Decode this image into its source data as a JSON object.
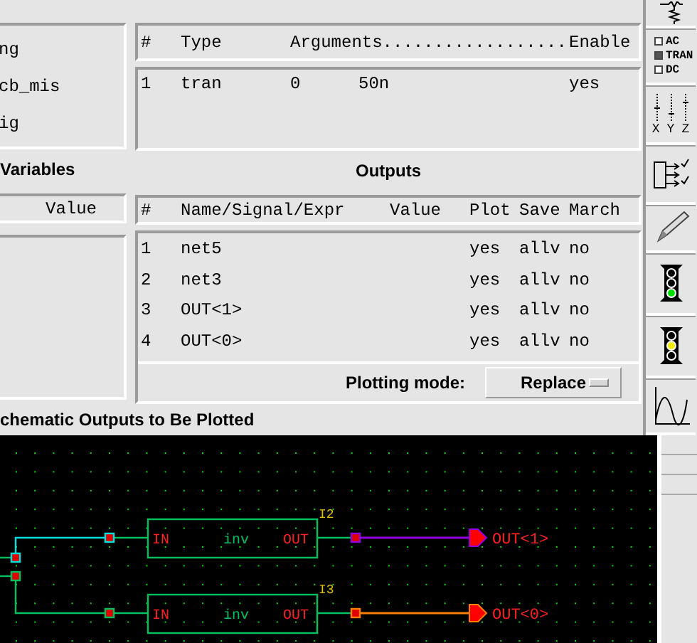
{
  "left_list": {
    "items": [
      "ng",
      "cb_mis",
      "ig"
    ]
  },
  "analyses": {
    "columns": [
      "#",
      "Type",
      "Arguments..................",
      "Enable"
    ],
    "rows": [
      {
        "index": "1",
        "type": "tran",
        "args": [
          "0",
          "50n"
        ],
        "enable": "yes"
      }
    ]
  },
  "variables": {
    "title": "Variables",
    "columns": [
      "Value"
    ]
  },
  "outputs": {
    "title": "Outputs",
    "columns": [
      "#",
      "Name/Signal/Expr",
      "Value",
      "Plot",
      "Save",
      "March"
    ],
    "rows": [
      {
        "index": "1",
        "name": "net5",
        "plot": "yes",
        "save": "allv",
        "march": "no"
      },
      {
        "index": "2",
        "name": "net3",
        "plot": "yes",
        "save": "allv",
        "march": "no"
      },
      {
        "index": "3",
        "name": "OUT<1>",
        "plot": "yes",
        "save": "allv",
        "march": "no"
      },
      {
        "index": "4",
        "name": "OUT<0>",
        "plot": "yes",
        "save": "allv",
        "march": "no"
      }
    ]
  },
  "plotting_mode": {
    "label": "Plotting mode:",
    "value": "Replace"
  },
  "footer": "chematic Outputs to Be Plotted",
  "toolbar": {
    "analysis_types": [
      {
        "label": "AC",
        "selected": false
      },
      {
        "label": "TRAN",
        "selected": true
      },
      {
        "label": "DC",
        "selected": false
      }
    ],
    "axis_labels": [
      "X",
      "Y",
      "Z"
    ]
  },
  "schematic": {
    "instances": [
      {
        "name": "I2",
        "cell": "inv",
        "pins": [
          "IN",
          "OUT"
        ],
        "output": "OUT<1>"
      },
      {
        "name": "I3",
        "cell": "inv",
        "pins": [
          "IN",
          "OUT"
        ],
        "output": "OUT<0>"
      }
    ]
  }
}
